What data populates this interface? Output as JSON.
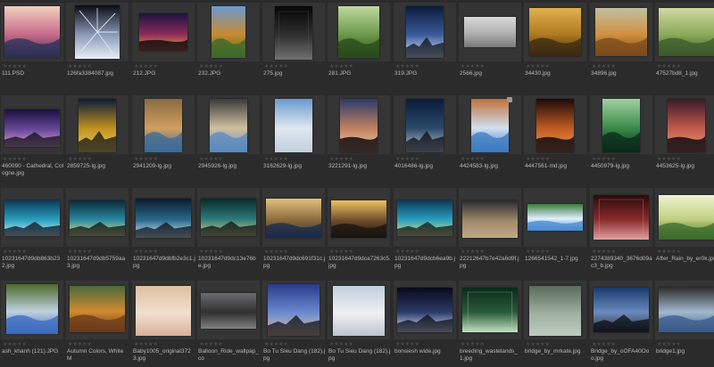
{
  "browser": {
    "star_glyph": "★★★★★",
    "rows": [
      [
        {
          "name": "111.PSD",
          "colors": [
            "#2a2f55",
            "#c86a8a",
            "#f0d0c0"
          ],
          "shape": "land"
        },
        {
          "name": "126fa3384087.jpg",
          "colors": [
            "#0a0a14",
            "#8a9ab8",
            "#e8eef8"
          ],
          "shape": "burst"
        },
        {
          "name": "212.JPG",
          "colors": [
            "#1a1440",
            "#8a2a5a",
            "#f0a040"
          ],
          "shape": "sunset"
        },
        {
          "name": "232.JPG",
          "colors": [
            "#3a6a2a",
            "#c88a30",
            "#6a9ad0"
          ],
          "shape": "land"
        },
        {
          "name": "275.jpg",
          "colors": [
            "#050505",
            "#303030",
            "#707070"
          ],
          "shape": "dark"
        },
        {
          "name": "281.JPG",
          "colors": [
            "#2a4a1a",
            "#6a9a4a",
            "#c0d8a0"
          ],
          "shape": "land"
        },
        {
          "name": "319.JPG",
          "colors": [
            "#0a1a3a",
            "#3a5a9a",
            "#e0e8ff"
          ],
          "shape": "night"
        },
        {
          "name": "2566.jpg",
          "colors": [
            "#d8d8d8",
            "#b0b0b0",
            "#404040"
          ],
          "shape": "mist"
        },
        {
          "name": "34430.jpg",
          "colors": [
            "#3a2a10",
            "#b07a20",
            "#e0b050"
          ],
          "shape": "land"
        },
        {
          "name": "34896.jpg",
          "colors": [
            "#7a4a1a",
            "#d09040",
            "#c0c0a0"
          ],
          "shape": "land"
        },
        {
          "name": "47527bd8_1.jpg",
          "colors": [
            "#3a5a2a",
            "#8aaa5a",
            "#d0d8a0"
          ],
          "shape": "land"
        }
      ],
      [
        {
          "name": "460090 - Cathedral, Cologne.jpg",
          "colors": [
            "#1a1040",
            "#6a4a9a",
            "#e0a0d0"
          ],
          "shape": "night"
        },
        {
          "name": "2859725-lg.jpg",
          "colors": [
            "#0a1a3a",
            "#c09020",
            "#f0d060"
          ],
          "shape": "night"
        },
        {
          "name": "2941209-lg.jpg",
          "colors": [
            "#3a6a9a",
            "#d0a060",
            "#8a6a40"
          ],
          "shape": "land"
        },
        {
          "name": "2945926-lg.jpg",
          "colors": [
            "#5a8ac0",
            "#d0c0a0",
            "#3a3a3a"
          ],
          "shape": "land"
        },
        {
          "name": "3162629-lg.jpg",
          "colors": [
            "#6a9ad0",
            "#e0e8f0",
            "#a0b8c8"
          ],
          "shape": "mist"
        },
        {
          "name": "3221291-lg.jpg",
          "colors": [
            "#2a3a6a",
            "#c08060",
            "#f0d0a0"
          ],
          "shape": "sunset"
        },
        {
          "name": "4016486-lg.jpg",
          "colors": [
            "#0a1a3a",
            "#2a4a6a",
            "#c0c8d0"
          ],
          "shape": "night"
        },
        {
          "name": "4424583-lg.jpg",
          "colors": [
            "#3a7ac0",
            "#d0e0f0",
            "#c0703a"
          ],
          "shape": "land"
        },
        {
          "name": "4447561-md.jpg",
          "colors": [
            "#1a0a0a",
            "#c05a20",
            "#f0a050"
          ],
          "shape": "sunset"
        },
        {
          "name": "4450979-lg.jpg",
          "colors": [
            "#0a2a1a",
            "#3a8a4a",
            "#a0d0a0"
          ],
          "shape": "land"
        },
        {
          "name": "4453625-lg.jpg",
          "colors": [
            "#3a1a2a",
            "#c05a4a",
            "#f0a080"
          ],
          "shape": "sunset"
        }
      ],
      [
        {
          "name": "10231647d9db863b232.jpg",
          "colors": [
            "#0a3a5a",
            "#2aa0c0",
            "#d0f0ff"
          ],
          "shape": "night"
        },
        {
          "name": "10231647d9db5759aa3.jpg",
          "colors": [
            "#0a2a3a",
            "#2a8aa0",
            "#f0e080"
          ],
          "shape": "night"
        },
        {
          "name": "10231647d9dbfb2e3c1.jpg",
          "colors": [
            "#0a1a2a",
            "#2a6a8a",
            "#e0f0ff"
          ],
          "shape": "night"
        },
        {
          "name": "10231647d9dc13e76be.jpg",
          "colors": [
            "#0a2a2a",
            "#2a7a7a",
            "#e0d080"
          ],
          "shape": "night"
        },
        {
          "name": "10231647d9dc691f31c.jpg",
          "colors": [
            "#1a2a4a",
            "#8a6a3a",
            "#e0c080"
          ],
          "shape": "land"
        },
        {
          "name": "10231647d9dca7263c5.jpg",
          "colors": [
            "#1a1410",
            "#6a4a2a",
            "#f0c060"
          ],
          "shape": "land"
        },
        {
          "name": "10231647d9dcb6ea9b.jpg",
          "colors": [
            "#0a3a5a",
            "#2aa0c0",
            "#f0e080"
          ],
          "shape": "night"
        },
        {
          "name": "22212647b7e42a6d9f.jpg",
          "colors": [
            "#2a2a30",
            "#a08a6a",
            "#e0c8a0"
          ],
          "shape": "mist"
        },
        {
          "name": "1266541542_1-7.jpg",
          "colors": [
            "#4a8ad0",
            "#e0f0ff",
            "#3a7a3a"
          ],
          "shape": "land"
        },
        {
          "name": "2274389340_3676d09ac3_b.jpg",
          "colors": [
            "#2a0a0a",
            "#8a2a2a",
            "#e0a0a0"
          ],
          "shape": "dark"
        },
        {
          "name": "After_Rain_by_er0k.jpg",
          "colors": [
            "#3a6a2a",
            "#c0d080",
            "#f0f0d0"
          ],
          "shape": "land"
        }
      ],
      [
        {
          "name": "ash_khanh (121).JPG",
          "colors": [
            "#3a6ac0",
            "#c0d0e0",
            "#4a6a2a"
          ],
          "shape": "land"
        },
        {
          "name": "Autumn Colors, White M",
          "colors": [
            "#6a3a1a",
            "#d08a30",
            "#4a6a3a"
          ],
          "shape": "land"
        },
        {
          "name": "Baby1005_original3723.jpg",
          "colors": [
            "#e0c0a0",
            "#f0e0d0",
            "#c08060"
          ],
          "shape": "mist"
        },
        {
          "name": "Balloon_Ride_wallpap_co",
          "colors": [
            "#6a6a70",
            "#303030",
            "#d0d0d0"
          ],
          "shape": "mist"
        },
        {
          "name": "Bo Tu Sieu Dang (182).jpg",
          "colors": [
            "#2a3a8a",
            "#6a8ad0",
            "#e0c0a0"
          ],
          "shape": "night"
        },
        {
          "name": "Bo Tu Sieu Dang (182).jpg",
          "colors": [
            "#c0d0e0",
            "#f0f0f0",
            "#8a9ab0"
          ],
          "shape": "mist"
        },
        {
          "name": "bonsiesh wide.jpg",
          "colors": [
            "#0a0a1a",
            "#2a3a6a",
            "#e0e8ff"
          ],
          "shape": "night"
        },
        {
          "name": "breeding_wastelands_1.jpg",
          "colors": [
            "#0a2a1a",
            "#2a5a3a",
            "#c0e0c0"
          ],
          "shape": "dark"
        },
        {
          "name": "bridge_by_mrkate.jpg",
          "colors": [
            "#5a6a5a",
            "#a0b0a0",
            "#e0e8e0"
          ],
          "shape": "mist"
        },
        {
          "name": "Bridge_by_oOFA40Ooo.jpg",
          "colors": [
            "#1a3a6a",
            "#6a8ac0",
            "#303030"
          ],
          "shape": "night"
        },
        {
          "name": "bridge1.jpg",
          "colors": [
            "#3a5a8a",
            "#a0b8d0",
            "#303030"
          ],
          "shape": "land"
        }
      ]
    ],
    "badges": [
      {
        "row": 1,
        "col": 7
      }
    ]
  }
}
